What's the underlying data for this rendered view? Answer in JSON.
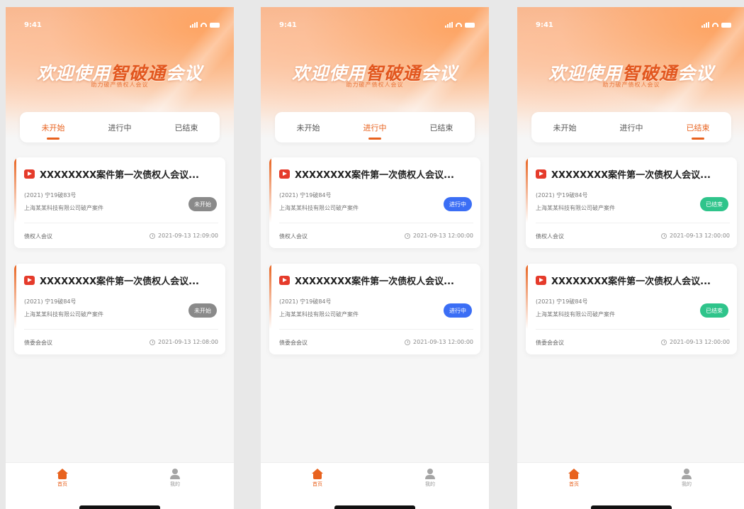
{
  "status_time": "9:41",
  "banner": {
    "title_before": "欢迎使用",
    "title_brand": "智破通",
    "title_after": "会议",
    "subtitle": "助力破产债权人会议"
  },
  "tabs": [
    "未开始",
    "进行中",
    "已结束"
  ],
  "nav": {
    "home": "首页",
    "mine": "我的"
  },
  "colors": {
    "accent": "#e8621e",
    "badge_not_started": "#8a8a8a",
    "badge_in_progress": "#3b6ef5",
    "badge_ended": "#2fc48b"
  },
  "screens": [
    {
      "active_tab": 0,
      "cards": [
        {
          "title": "XXXXXXXX案件第一次债权人会议...",
          "case_no": "(2021) 宁19破83号",
          "debtor": "上海某某科技有限公司破产案件",
          "badge": "未开始",
          "badge_color": "#8a8a8a",
          "meeting_type": "债权人会议",
          "time": "2021-09-13 12:09:00"
        },
        {
          "title": "XXXXXXXX案件第一次债权人会议...",
          "case_no": "(2021) 宁19破84号",
          "debtor": "上海某某科技有限公司破产案件",
          "badge": "未开始",
          "badge_color": "#8a8a8a",
          "meeting_type": "债委会会议",
          "time": "2021-09-13 12:08:00"
        }
      ]
    },
    {
      "active_tab": 1,
      "cards": [
        {
          "title": "XXXXXXXX案件第一次债权人会议...",
          "case_no": "(2021) 宁19破84号",
          "debtor": "上海某某科技有限公司破产案件",
          "badge": "进行中",
          "badge_color": "#3b6ef5",
          "meeting_type": "债权人会议",
          "time": "2021-09-13 12:00:00"
        },
        {
          "title": "XXXXXXXX案件第一次债权人会议...",
          "case_no": "(2021) 宁19破84号",
          "debtor": "上海某某科技有限公司破产案件",
          "badge": "进行中",
          "badge_color": "#3b6ef5",
          "meeting_type": "债委会会议",
          "time": "2021-09-13 12:00:00"
        }
      ]
    },
    {
      "active_tab": 2,
      "cards": [
        {
          "title": "XXXXXXXX案件第一次债权人会议...",
          "case_no": "(2021) 宁19破84号",
          "debtor": "上海某某科技有限公司破产案件",
          "badge": "已结束",
          "badge_color": "#2fc48b",
          "meeting_type": "债权人会议",
          "time": "2021-09-13 12:00:00"
        },
        {
          "title": "XXXXXXXX案件第一次债权人会议...",
          "case_no": "(2021) 宁19破84号",
          "debtor": "上海某某科技有限公司破产案件",
          "badge": "已结束",
          "badge_color": "#2fc48b",
          "meeting_type": "债委会会议",
          "time": "2021-09-13 12:00:00"
        }
      ]
    }
  ]
}
